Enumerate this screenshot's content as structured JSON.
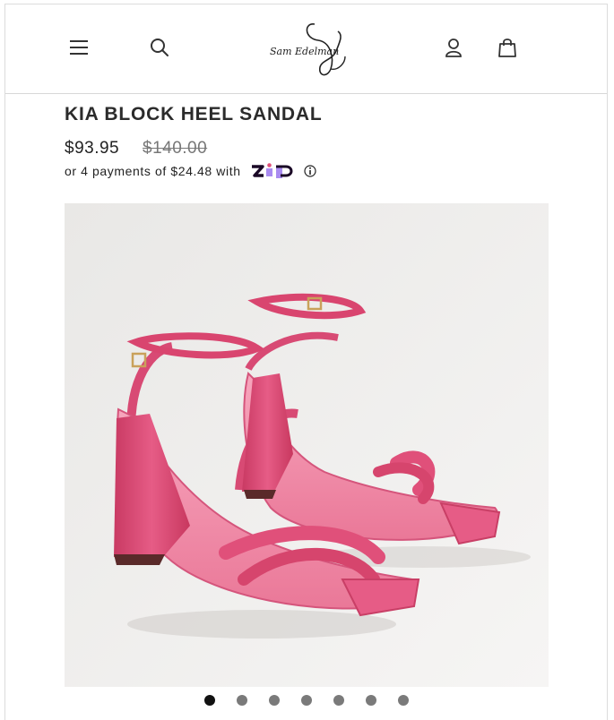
{
  "header": {
    "menu_icon": "hamburger-menu-icon",
    "search_icon": "search-icon",
    "logo_text": "Sam Edelman",
    "account_icon": "user-icon",
    "bag_icon": "shopping-bag-icon"
  },
  "product": {
    "title": "KIA BLOCK HEEL SANDAL",
    "sale_price": "$93.95",
    "original_price": "$140.00",
    "installment_prefix": "or 4 payments of ",
    "installment_amount": "$24.48",
    "installment_suffix": " with",
    "installment_provider": "Zip",
    "image_alt": "Pink block heel sandals"
  },
  "carousel": {
    "total": 7,
    "active_index": 0
  },
  "colors": {
    "sandal_pink": "#e0507a",
    "zip_purple": "#a98bf0",
    "zip_dark": "#1a0826",
    "background_image": "#f0efed"
  }
}
